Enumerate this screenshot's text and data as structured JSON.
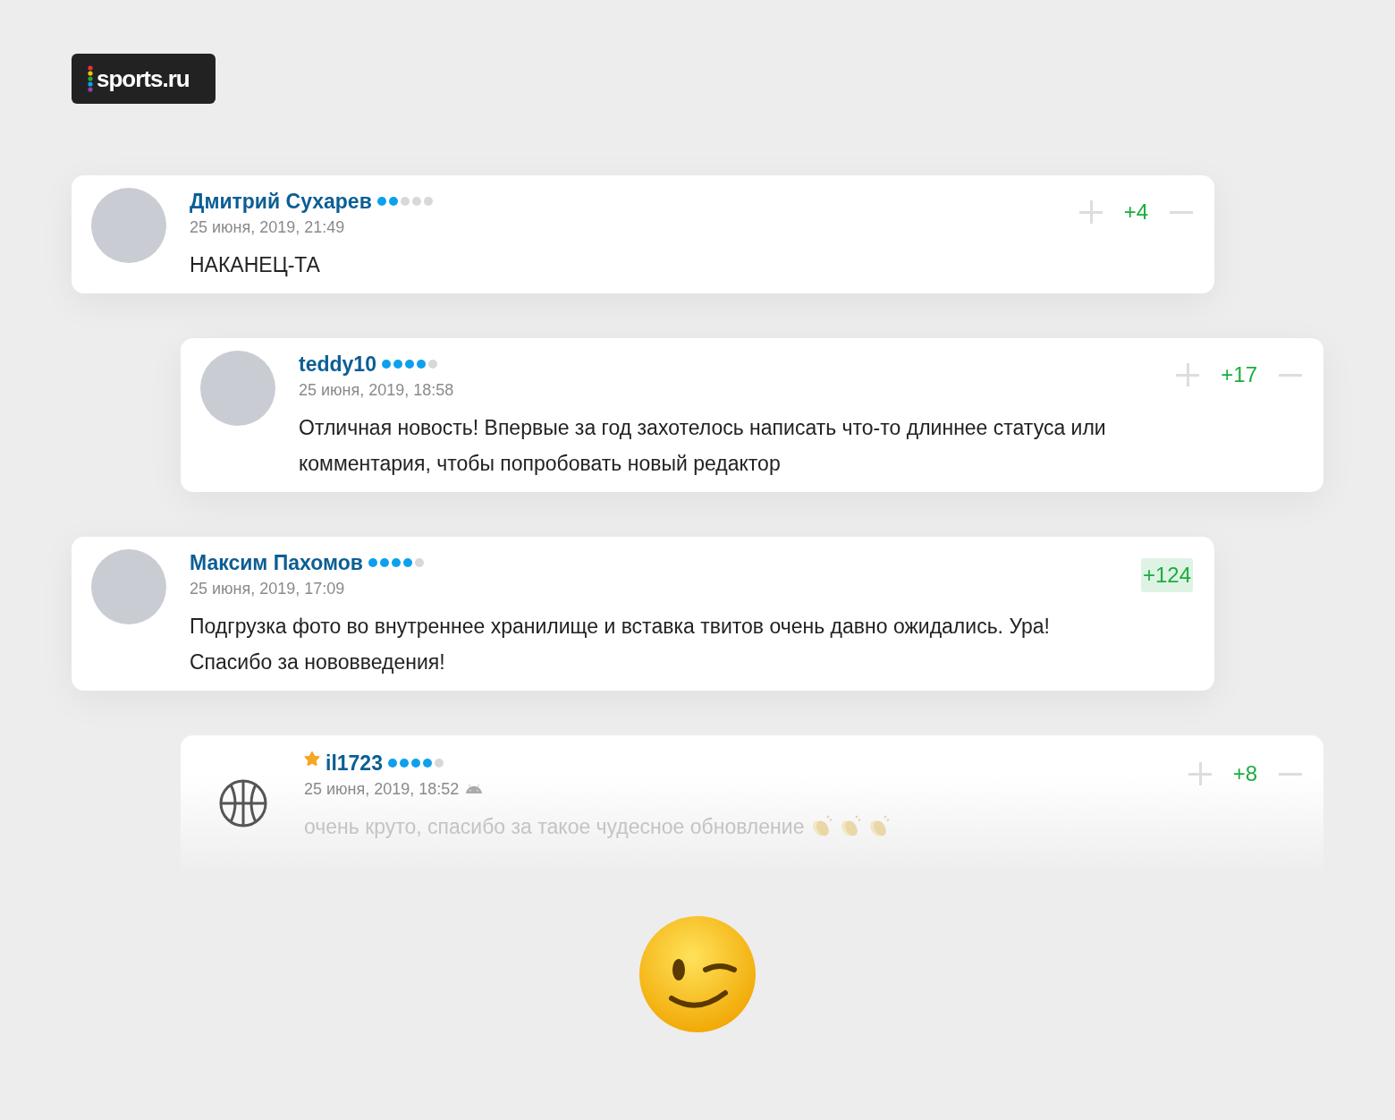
{
  "logo": {
    "text": "sports.ru"
  },
  "comments": [
    {
      "author": "Дмитрий Сухарев",
      "starred": false,
      "stars": 2,
      "date": "25 июня, 2019, 21:49",
      "device": false,
      "avatar": {
        "kind": "photo"
      },
      "text": "НАКАНЕЦ-ТА",
      "rating": "+4",
      "vote_buttons": true,
      "rating_highlighted": false,
      "indented": false,
      "faded": false
    },
    {
      "author": "teddy10",
      "starred": false,
      "stars": 4,
      "date": "25 июня, 2019, 18:58",
      "device": false,
      "avatar": {
        "kind": "photo"
      },
      "text": "Отличная новость! Впервые за год захотелось написать что-то длиннее статуса или комментария, чтобы попробовать новый редактор",
      "rating": "+17",
      "vote_buttons": true,
      "rating_highlighted": false,
      "indented": true,
      "faded": false
    },
    {
      "author": "Максим Пахомов",
      "starred": false,
      "stars": 4,
      "date": "25 июня, 2019, 17:09",
      "device": false,
      "avatar": {
        "kind": "photo"
      },
      "text": "Подгрузка фото во внутреннее хранилище и вставка твитов очень давно ожидались. Ура! Спасибо за нововведения!",
      "rating": "+124",
      "vote_buttons": false,
      "rating_highlighted": true,
      "indented": false,
      "faded": false
    },
    {
      "author": "il1723",
      "starred": true,
      "stars": 4,
      "date": "25 июня, 2019, 18:52",
      "device": true,
      "avatar": {
        "kind": "ball"
      },
      "text": "очень круто, спасибо за такое чудесное обновление",
      "reactions": [
        {
          "kind": "clap"
        },
        {
          "kind": "clap"
        },
        {
          "kind": "clap"
        }
      ],
      "rating": "+8",
      "vote_buttons": true,
      "rating_highlighted": false,
      "indented": true,
      "faded": true
    }
  ]
}
